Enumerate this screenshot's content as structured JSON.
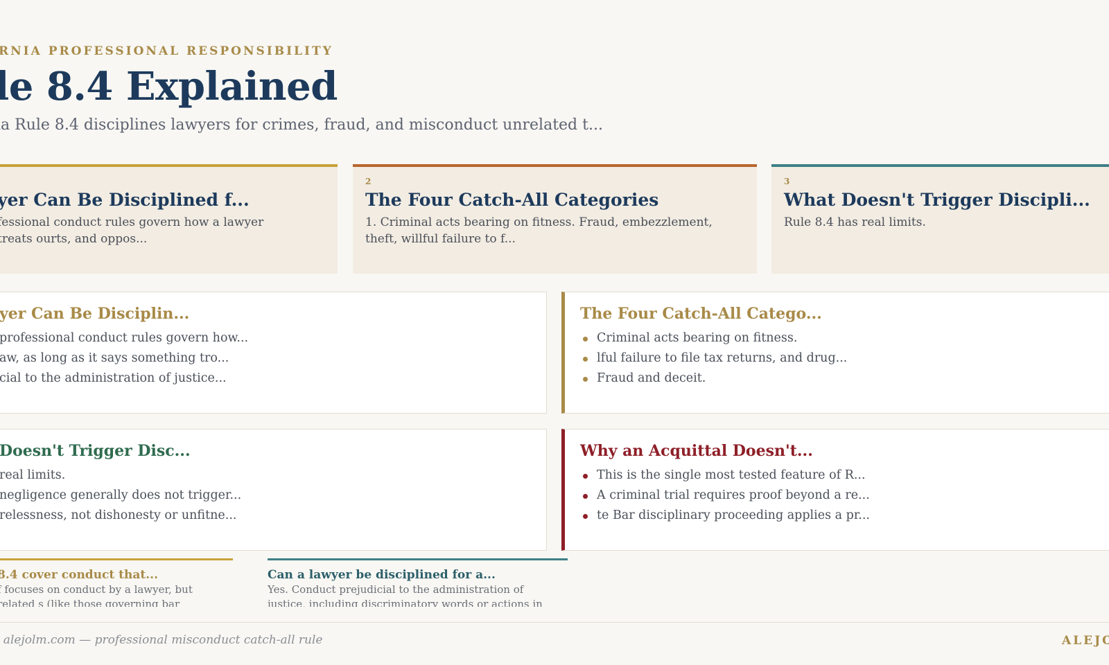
{
  "header": {
    "kicker": "RNIA PROFESSIONAL RESPONSIBILITY",
    "title": "le 8.4 Explained",
    "subtitle": "ia Rule 8.4 disciplines lawyers for crimes, fraud, and misconduct unrelated t..."
  },
  "cards": [
    {
      "number": "",
      "title": "yer Can Be Disciplined f...",
      "body": "fessional conduct rules govern how a lawyer treats ourts, and oppos...",
      "accent": "#c8a23a"
    },
    {
      "number": "2",
      "title": "The Four Catch-All Categories",
      "body": "1. Criminal acts bearing on fitness. Fraud, embezzlement, theft, willful failure to f...",
      "accent": "#b8662e"
    },
    {
      "number": "3",
      "title": "What Doesn't Trigger Discipli...",
      "body": "Rule 8.4 has real limits.",
      "accent": "#3e7f87"
    }
  ],
  "sections": [
    {
      "title": "yer Can Be Disciplin...",
      "color": "#a88a48",
      "items": [
        "professional conduct rules govern how...",
        "aw, as long as it says something tro...",
        "cial to the administration of justice..."
      ]
    },
    {
      "title": "The Four Catch-All Catego...",
      "color": "#a88a48",
      "items": [
        "Criminal acts bearing on fitness.",
        "lful failure to file tax returns, and drug...",
        "Fraud and deceit."
      ]
    },
    {
      "title": "Doesn't Trigger Disc...",
      "color": "#2f6b4f",
      "items": [
        "real limits.",
        "negligence generally does not trigger...",
        "relessness, not dishonesty or unfitne..."
      ]
    },
    {
      "title": "Why an Acquittal Doesn't...",
      "color": "#8e1f28",
      "items": [
        "This is the single most tested feature of R...",
        "A criminal trial requires proof beyond a re...",
        "te Bar disciplinary proceeding applies a pr..."
      ]
    }
  ],
  "faqs": [
    {
      "question": "8.4 cover conduct that...",
      "answer": "f focuses on conduct by a lawyer, but related s (like those governing bar admissi...",
      "color": "#a88a48",
      "accent": "#c8a23a"
    },
    {
      "question": "Can a lawyer be disciplined for a...",
      "answer": "Yes. Conduct prejudicial to the administration of justice, including discriminatory words or actions in conne...",
      "color": "#2c5f6a",
      "accent": "#3e7f87"
    }
  ],
  "footer": {
    "left": "· alejolm.com — professional misconduct catch-all rule",
    "right": "ALEJO"
  }
}
